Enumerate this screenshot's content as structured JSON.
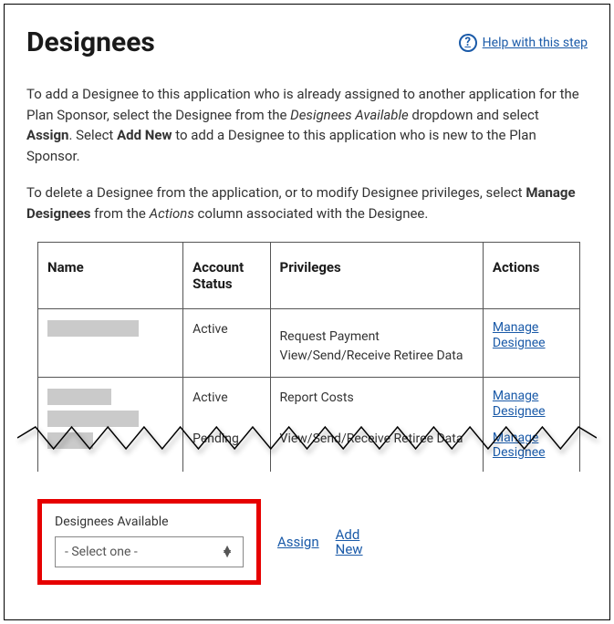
{
  "header": {
    "title": "Designees",
    "help_label": " Help with this step"
  },
  "intro": {
    "p1_a": "To add a Designee to this application who is already assigned to another application for the Plan Sponsor, select the Designee from the ",
    "p1_em": "Designees Available",
    "p1_b": " dropdown and select ",
    "p1_strong1": "Assign",
    "p1_c": ". Select ",
    "p1_strong2": "Add New",
    "p1_d": " to add a Designee to this application who is new to the Plan Sponsor.",
    "p2_a": "To delete a Designee from the application, or to modify Designee privileges, select ",
    "p2_strong": "Manage Designees",
    "p2_b": " from the ",
    "p2_em": "Actions",
    "p2_c": " column associated with the Designee."
  },
  "table": {
    "headers": {
      "name": "Name",
      "status": "Account Status",
      "privileges": "Privileges",
      "actions": "Actions"
    },
    "rows": [
      {
        "status": "Active",
        "priv1": "Request Payment",
        "priv2": "View/Send/Receive Retiree Data",
        "action": "Manage Designee"
      },
      {
        "status": "Active",
        "priv1": "Report Costs",
        "action": "Manage Designee"
      },
      {
        "status": "Pending",
        "priv1": "View/Send/Receive Retiree Data",
        "action": "Manage Designee"
      }
    ]
  },
  "footer": {
    "da_label": "Designees Available",
    "select_placeholder": "- Select one -",
    "assign_label": "Assign",
    "addnew_label": "Add New"
  }
}
